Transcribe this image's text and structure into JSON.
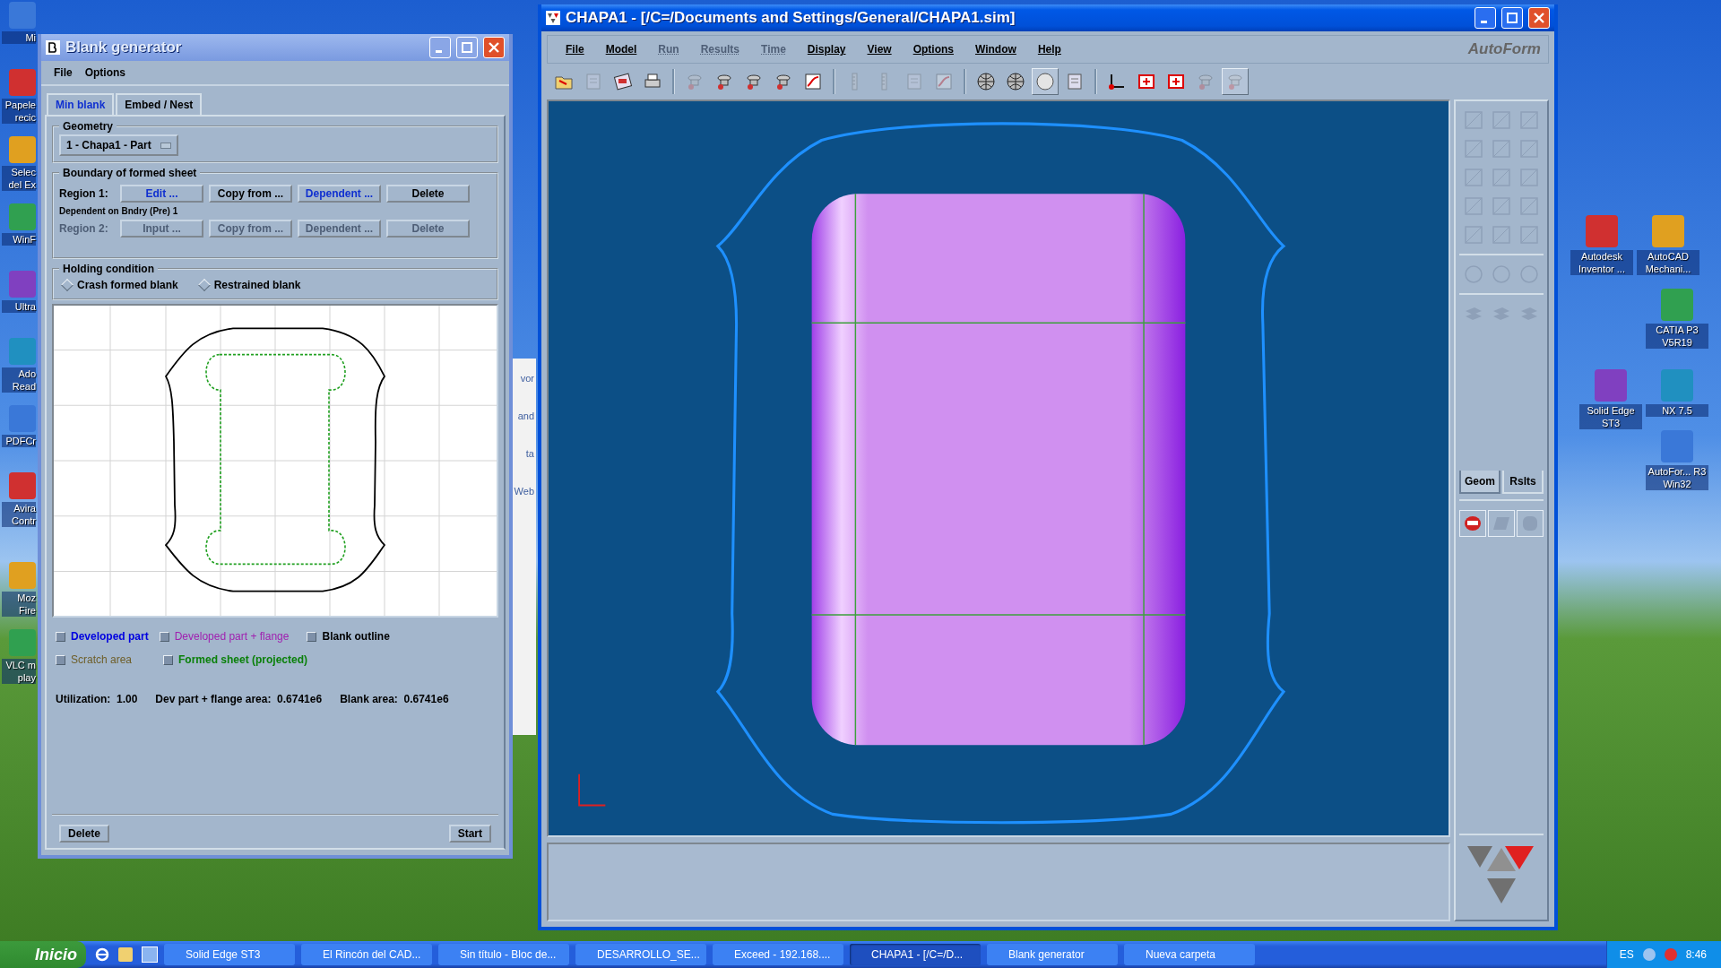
{
  "desktop": {
    "left_icons": [
      {
        "label": "Mi"
      },
      {
        "label": "Papele recic"
      },
      {
        "label": "Selec del Ex"
      },
      {
        "label": "WinF"
      },
      {
        "label": "Ultra"
      },
      {
        "label": "Ado Read"
      },
      {
        "label": "PDFCr"
      },
      {
        "label": "Avira Contr"
      },
      {
        "label": "Moz Fire"
      },
      {
        "label": "VLC m play"
      }
    ],
    "right_icons": [
      {
        "label": "Autodesk Inventor ..."
      },
      {
        "label": "AutoCAD Mechani..."
      },
      {
        "label": "CATIA P3 V5R19"
      },
      {
        "label": "Solid Edge ST3"
      },
      {
        "label": "NX 7.5"
      },
      {
        "label": "AutoFor... R3 Win32"
      }
    ],
    "background_window": {
      "texts": [
        "vor",
        "and",
        "ta",
        "Web"
      ]
    }
  },
  "blank_generator": {
    "title": "Blank generator",
    "menu": [
      "File",
      "Options"
    ],
    "tabs": [
      {
        "label": "Min blank",
        "selected": true
      },
      {
        "label": "Embed / Nest",
        "selected": false
      }
    ],
    "geometry": {
      "legend": "Geometry",
      "dropdown": "1 - Chapa1 - Part"
    },
    "boundary": {
      "legend": "Boundary of formed sheet",
      "regions": [
        {
          "label": "Region 1:",
          "disabled": false,
          "note": "Dependent on Bndry (Pre) 1",
          "buttons": [
            {
              "label": "Edit ...",
              "highlighted": true
            },
            {
              "label": "Copy from ...",
              "highlighted": false
            },
            {
              "label": "Dependent ...",
              "highlighted": true
            },
            {
              "label": "Delete",
              "highlighted": false
            }
          ]
        },
        {
          "label": "Region 2:",
          "disabled": true,
          "buttons": [
            {
              "label": "Input ...",
              "highlighted": false
            },
            {
              "label": "Copy from ...",
              "highlighted": false
            },
            {
              "label": "Dependent ...",
              "highlighted": false
            },
            {
              "label": "Delete",
              "highlighted": false
            }
          ]
        }
      ]
    },
    "holding": {
      "legend": "Holding condition",
      "options": [
        {
          "label": "Crash formed blank",
          "selected": false
        },
        {
          "label": "Restrained blank",
          "selected": false
        }
      ]
    },
    "legend_items": [
      {
        "label": "Developed part",
        "color": "#0000e0",
        "checked": false,
        "disabled": false
      },
      {
        "label": "Developed part + flange",
        "color": "#a020b0",
        "checked": false,
        "disabled": true
      },
      {
        "label": "Blank outline",
        "color": "#000000",
        "checked": false,
        "disabled": false
      },
      {
        "label": "Scratch area",
        "color": "#6e5e28",
        "checked": false,
        "disabled": true
      },
      {
        "label": "Formed sheet (projected)",
        "color": "#0a800a",
        "checked": false,
        "disabled": false
      }
    ],
    "stats": [
      "Utilization:  1.00",
      "Dev part + flange area:  0.6741e6",
      "Blank area:  0.6741e6"
    ],
    "buttons": [
      "Delete",
      "Start"
    ]
  },
  "main_window": {
    "title": "CHAPA1 - [/C=/Documents and Settings/General/CHAPA1.sim]",
    "menu": [
      {
        "label": "File",
        "disabled": false
      },
      {
        "label": "Model",
        "disabled": false
      },
      {
        "label": "Run",
        "disabled": true
      },
      {
        "label": "Results",
        "disabled": true
      },
      {
        "label": "Time",
        "disabled": true
      },
      {
        "label": "Display",
        "disabled": false
      },
      {
        "label": "View",
        "disabled": false
      },
      {
        "label": "Options",
        "disabled": false
      },
      {
        "label": "Window",
        "disabled": false
      },
      {
        "label": "Help",
        "disabled": false
      }
    ],
    "logo": "AutoForm",
    "toolbar": [
      {
        "kind": "folder",
        "disabled": false,
        "pressed": false
      },
      {
        "kind": "page",
        "disabled": true,
        "pressed": false
      },
      {
        "kind": "save",
        "disabled": false,
        "pressed": false
      },
      {
        "kind": "print",
        "disabled": false,
        "pressed": false
      },
      {
        "kind": "sep"
      },
      {
        "kind": "tool",
        "disabled": true,
        "pressed": false
      },
      {
        "kind": "tool",
        "disabled": false,
        "pressed": false
      },
      {
        "kind": "tool",
        "disabled": false,
        "pressed": false
      },
      {
        "kind": "tool",
        "disabled": false,
        "pressed": false
      },
      {
        "kind": "curve",
        "disabled": false,
        "pressed": false
      },
      {
        "kind": "sep"
      },
      {
        "kind": "ruler",
        "disabled": true,
        "pressed": false
      },
      {
        "kind": "ruler",
        "disabled": true,
        "pressed": false
      },
      {
        "kind": "page",
        "disabled": true,
        "pressed": false
      },
      {
        "kind": "curve",
        "disabled": true,
        "pressed": false
      },
      {
        "kind": "sep"
      },
      {
        "kind": "sphere",
        "disabled": false,
        "pressed": false
      },
      {
        "kind": "sphere",
        "disabled": false,
        "pressed": false
      },
      {
        "kind": "shade",
        "disabled": false,
        "pressed": true
      },
      {
        "kind": "page",
        "disabled": false,
        "pressed": false
      },
      {
        "kind": "sep"
      },
      {
        "kind": "axes",
        "disabled": false,
        "pressed": false
      },
      {
        "kind": "frame",
        "disabled": false,
        "pressed": false
      },
      {
        "kind": "frame",
        "disabled": false,
        "pressed": false
      },
      {
        "kind": "tool",
        "disabled": true,
        "pressed": false
      },
      {
        "kind": "tool",
        "disabled": true,
        "pressed": true
      }
    ],
    "side_tabs": [
      {
        "label": "Geom",
        "selected": true
      },
      {
        "label": "Rslts",
        "selected": false
      }
    ]
  },
  "taskbar": {
    "start": "Inicio",
    "items": [
      {
        "label": "Solid Edge ST3",
        "selected": false
      },
      {
        "label": "El Rincón del CAD...",
        "selected": false
      },
      {
        "label": "Sin título - Bloc de...",
        "selected": false
      },
      {
        "label": "DESARROLLO_SE...",
        "selected": false
      },
      {
        "label": "Exceed - 192.168....",
        "selected": false
      },
      {
        "label": "CHAPA1 - [/C=/D...",
        "selected": true
      },
      {
        "label": "Blank generator",
        "selected": false
      },
      {
        "label": "Nueva carpeta",
        "selected": false
      }
    ],
    "language": "ES",
    "clock": "8:46"
  }
}
